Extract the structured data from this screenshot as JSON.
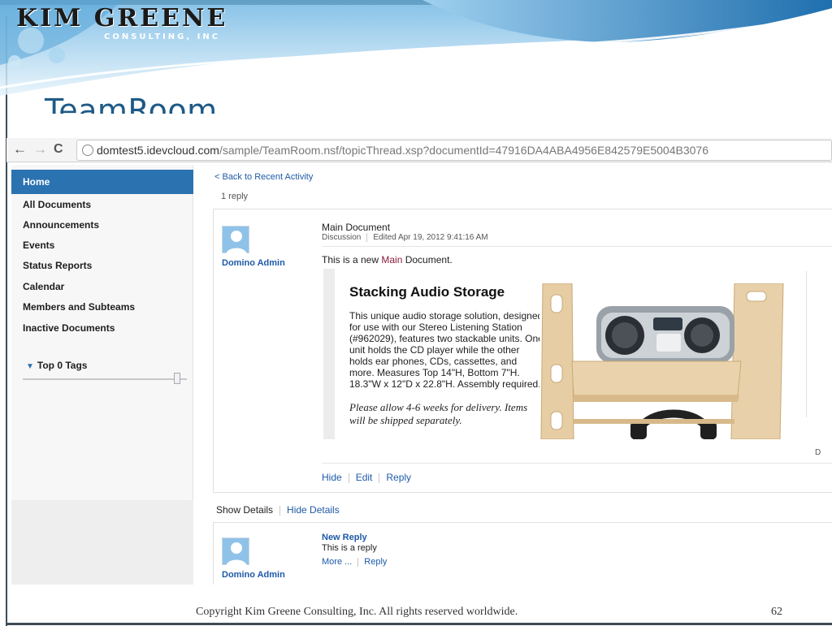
{
  "slide": {
    "brand_name": "KIM GREENE",
    "brand_sub": "CONSULTING, INC",
    "title": "TeamRoom",
    "copyright": "Copyright Kim Greene Consulting, Inc.  All rights reserved worldwide.",
    "page_number": "62"
  },
  "browser": {
    "url_host": "domtest5.idevcloud.com",
    "url_path": "/sample/TeamRoom.nsf/topicThread.xsp?documentId=47916DA4ABA4956E842579E5004B3076"
  },
  "sidebar": {
    "items": [
      {
        "label": "Home",
        "active": true
      },
      {
        "label": "All Documents"
      },
      {
        "label": "Announcements"
      },
      {
        "label": "Events"
      },
      {
        "label": "Status Reports"
      },
      {
        "label": "Calendar"
      },
      {
        "label": "Members and Subteams"
      },
      {
        "label": "Inactive Documents"
      }
    ],
    "tags_label": "Top 0 Tags"
  },
  "thread": {
    "back_link": "< Back to Recent Activity",
    "reply_count": "1 reply",
    "main_post": {
      "author": "Domino Admin",
      "title": "Main Document",
      "category": "Discussion",
      "edited": "Edited Apr 19, 2012 9:41:16 AM",
      "body_prefix": "This is a new ",
      "body_highlight": "Main",
      "body_suffix": " Document.",
      "actions": [
        "Hide",
        "Edit",
        "Reply"
      ]
    },
    "embed": {
      "product_title": "Stacking Audio Storage",
      "product_desc": "This unique audio storage solution, designed for use with our Stereo Listening Station (#962029), features two stackable units. One unit holds the CD player while the other holds ear phones, CDs, cassettes, and more. Measures Top 14\"H, Bottom 7\"H. 18.3\"W x 12\"D x 22.8\"H. Assembly required.",
      "product_note": "Please allow 4-6 weeks for delivery. Items will be shipped separately.",
      "edge_letter": "D"
    },
    "details": {
      "show": "Show Details",
      "hide": "Hide Details"
    },
    "reply": {
      "author": "Domino Admin",
      "title": "New Reply",
      "body": "This is a reply",
      "actions": [
        "More ...",
        "Reply"
      ]
    }
  },
  "colors": {
    "accent": "#2b73b0",
    "link": "#1e5aa8",
    "title": "#1f5a86",
    "highlight": "#8b1a3c"
  }
}
